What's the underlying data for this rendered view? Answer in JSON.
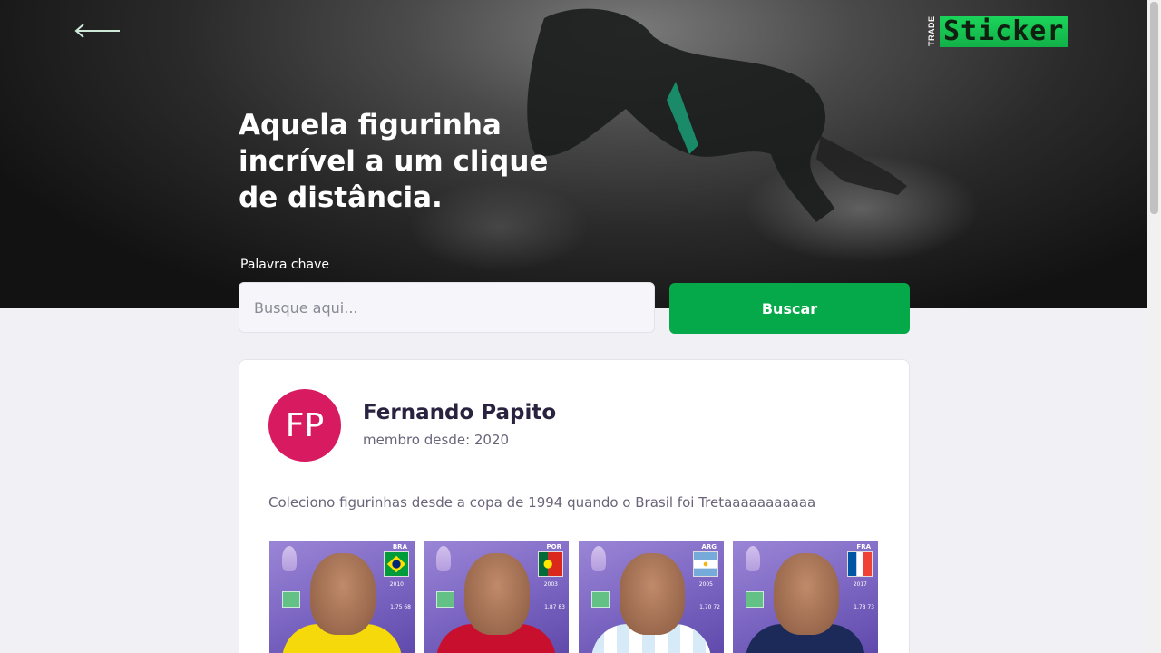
{
  "hero": {
    "headline": "Aquela figurinha incrível a um clique de distância.",
    "logo_small": "TRADE",
    "logo_main": "Sticker"
  },
  "search": {
    "label": "Palavra chave",
    "placeholder": "Busque aqui...",
    "value": "",
    "button_label": "Buscar"
  },
  "profile": {
    "initials": "FP",
    "name": "Fernando Papito",
    "member_since": "membro desde: 2020",
    "bio": "Coleciono figurinhas desde a copa de 1994 quando o Brasil foi Tretaaaaaaaaaaa"
  },
  "stickers": [
    {
      "code": "BRA",
      "year": "2010",
      "stats": "1,75  68",
      "flag": "brazil-flag-icon",
      "shirt_color": "#f5d90a"
    },
    {
      "code": "POR",
      "year": "2003",
      "stats": "1,87  83",
      "flag": "portugal-flag-icon",
      "shirt_color": "#c8102e"
    },
    {
      "code": "ARG",
      "year": "2005",
      "stats": "1,70  72",
      "flag": "argentina-flag-icon",
      "shirt_color": "#d6eaf8"
    },
    {
      "code": "FRA",
      "year": "2017",
      "stats": "1,78  73",
      "flag": "france-flag-icon",
      "shirt_color": "#1c2a5a"
    }
  ],
  "colors": {
    "accent": "#06a94a",
    "avatar": "#d81b60"
  }
}
